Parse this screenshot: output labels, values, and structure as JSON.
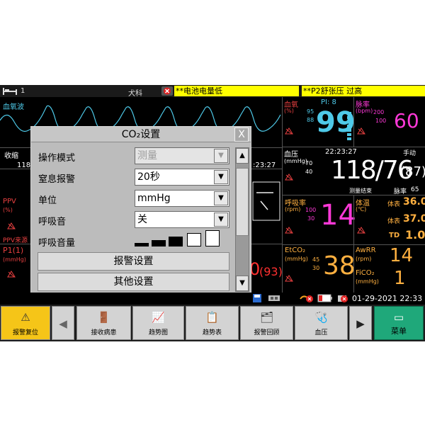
{
  "topbar": {
    "bed_number": "1",
    "department": "犬科",
    "alarm_1": "**电池电量低",
    "alarm_2": "**P2舒张压 过高"
  },
  "left_panel": {
    "spo2_wave_label": "血氧波",
    "systolic_label": "收缩",
    "partial_value": "118",
    "ppv_label": "PPV",
    "ppv_unit": "(%)",
    "ppv_source": "PPV来源",
    "p1_label": "P1(1)",
    "p1_unit": "(mmHg)",
    "p1_partial": "0",
    "p1_paren": "(93)",
    "partial_time": ":23:27"
  },
  "spo2": {
    "label": "血氧",
    "unit": "(%)",
    "pi_label": "PI: 8",
    "upper": "95",
    "lower": "88",
    "value": "99"
  },
  "pulse": {
    "label": "脉率",
    "unit": "(bpm)",
    "upper": "200",
    "lower": "100",
    "value": "60"
  },
  "nibp": {
    "label": "血压",
    "unit": "(mmHg)",
    "time": "22:23:27",
    "mode": "手动",
    "upper": "70",
    "lower": "40",
    "value": "118/76",
    "mean": "(87)",
    "status": "测量结束",
    "pr_label": "脉率",
    "pr_value": "65"
  },
  "resp": {
    "label": "呼吸率",
    "unit": "(rpm)",
    "upper": "100",
    "lower": "30",
    "value": "14"
  },
  "temp": {
    "label": "体温",
    "unit": "(℃)",
    "t1_label": "体表",
    "t1_value": "36.0",
    "t2_label": "体表",
    "t2_value": "37.0",
    "td_label": "TD",
    "td_value": "1.0"
  },
  "etco2": {
    "label": "EtCO₂",
    "unit": "(mmHg)",
    "upper": "45",
    "lower": "30",
    "value": "38"
  },
  "awrr": {
    "label": "AwRR",
    "unit": "(rpm)",
    "value": "14"
  },
  "fico2": {
    "label": "FiCO₂",
    "unit": "(mmHg)",
    "value": "1"
  },
  "dialog": {
    "title": "CO₂设置",
    "close": "X",
    "rows": [
      {
        "label": "操作模式",
        "value": "测量",
        "disabled": true
      },
      {
        "label": "窒息报警",
        "value": "20秒",
        "disabled": false
      },
      {
        "label": "单位",
        "value": "mmHg",
        "disabled": false
      },
      {
        "label": "呼吸音",
        "value": "关",
        "disabled": false
      }
    ],
    "volume_label": "呼吸音量",
    "volume_level_fraction": 0.6,
    "alarm_settings_button": "报警设置",
    "other_settings_button": "其他设置"
  },
  "statusline": {
    "datetime": "01-29-2021 22:33"
  },
  "bottombar": {
    "alarm_reset": "报警复位",
    "admit_patient": "接收病患",
    "trend_graph": "趋势图",
    "trend_table": "趋势表",
    "alarm_review": "报警回顾",
    "nibp": "血压",
    "menu": "菜单"
  },
  "colors": {
    "spo2": "#4ec9e8",
    "nibp": "#ffffff",
    "resp": "#ff39d8",
    "pulse": "#ff39d8",
    "etco2": "#ffb040",
    "alarm_yellow": "#ffff00",
    "alarm_reset_bg": "#f5c518",
    "menu_bg": "#1fa87a"
  }
}
